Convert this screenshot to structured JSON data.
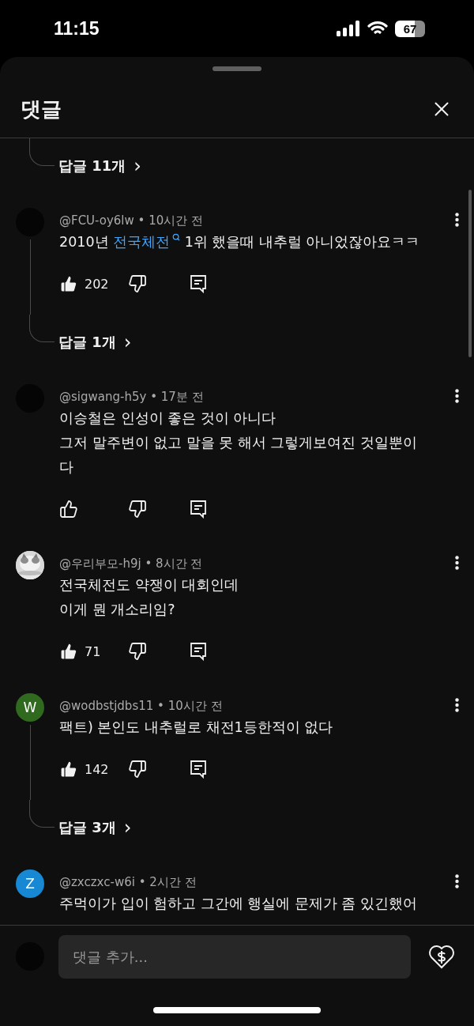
{
  "status_bar": {
    "time": "11:15",
    "battery": "67"
  },
  "sheet": {
    "title": "댓글"
  },
  "comments": [
    {
      "kind": "replies",
      "label": "답글 11개",
      "chevron": "›"
    },
    {
      "kind": "comment",
      "avatar": {
        "kind": "blank"
      },
      "user": "@FCU-oy6lw",
      "sep": "•",
      "time": "10시간 전",
      "thread": true,
      "body": [
        [
          {
            "text": "2010년 "
          },
          {
            "text": "전국체전",
            "kind": "link"
          },
          {
            "text": " 1위 했을때 내추럴 아니었잖아요ㅋㅋ"
          }
        ]
      ],
      "liked": true,
      "likes": "202"
    },
    {
      "kind": "replies",
      "label": "답글 1개",
      "chevron": "›"
    },
    {
      "kind": "comment",
      "avatar": {
        "kind": "blank"
      },
      "user": "@sigwang-h5y",
      "sep": "•",
      "time": "17분 전",
      "body": [
        [
          {
            "text": "이승철은 인성이 좋은 것이 아니다"
          }
        ],
        [
          {
            "text": "그저 말주변이 없고 말을 못 해서 그렇게보여진 것일뿐이"
          }
        ],
        [
          {
            "text": "다"
          }
        ]
      ],
      "liked": false
    },
    {
      "kind": "comment",
      "avatar": {
        "kind": "picture"
      },
      "user": "@우리부모-h9j",
      "sep": "•",
      "time": "8시간 전",
      "body": [
        [
          {
            "text": "전국체전도 약쟁이 대회인데"
          }
        ],
        [
          {
            "text": "이게 뭔 개소리임?"
          }
        ]
      ],
      "liked": true,
      "likes": "71"
    },
    {
      "kind": "comment",
      "avatar": {
        "kind": "letter",
        "letter": "W",
        "color": "#2f6a1e"
      },
      "user": "@wodbstjdbs11",
      "sep": "•",
      "time": "10시간 전",
      "thread": true,
      "body": [
        [
          {
            "text": "팩트) 본인도 내추럴로 채전1등한적이 없다"
          }
        ]
      ],
      "liked": true,
      "likes": "142"
    },
    {
      "kind": "replies",
      "label": "답글 3개",
      "chevron": "›"
    },
    {
      "kind": "comment",
      "avatar": {
        "kind": "letter",
        "letter": "Z",
        "color": "#1789d4"
      },
      "user": "@zxczxc-w6i",
      "sep": "•",
      "time": "2시간 전",
      "body": [
        [
          {
            "text": "주먹이가 입이 험하고 그간에 행실에 문제가 좀 있긴했어"
          }
        ]
      ]
    }
  ],
  "footer": {
    "placeholder": "댓글 추가..."
  }
}
